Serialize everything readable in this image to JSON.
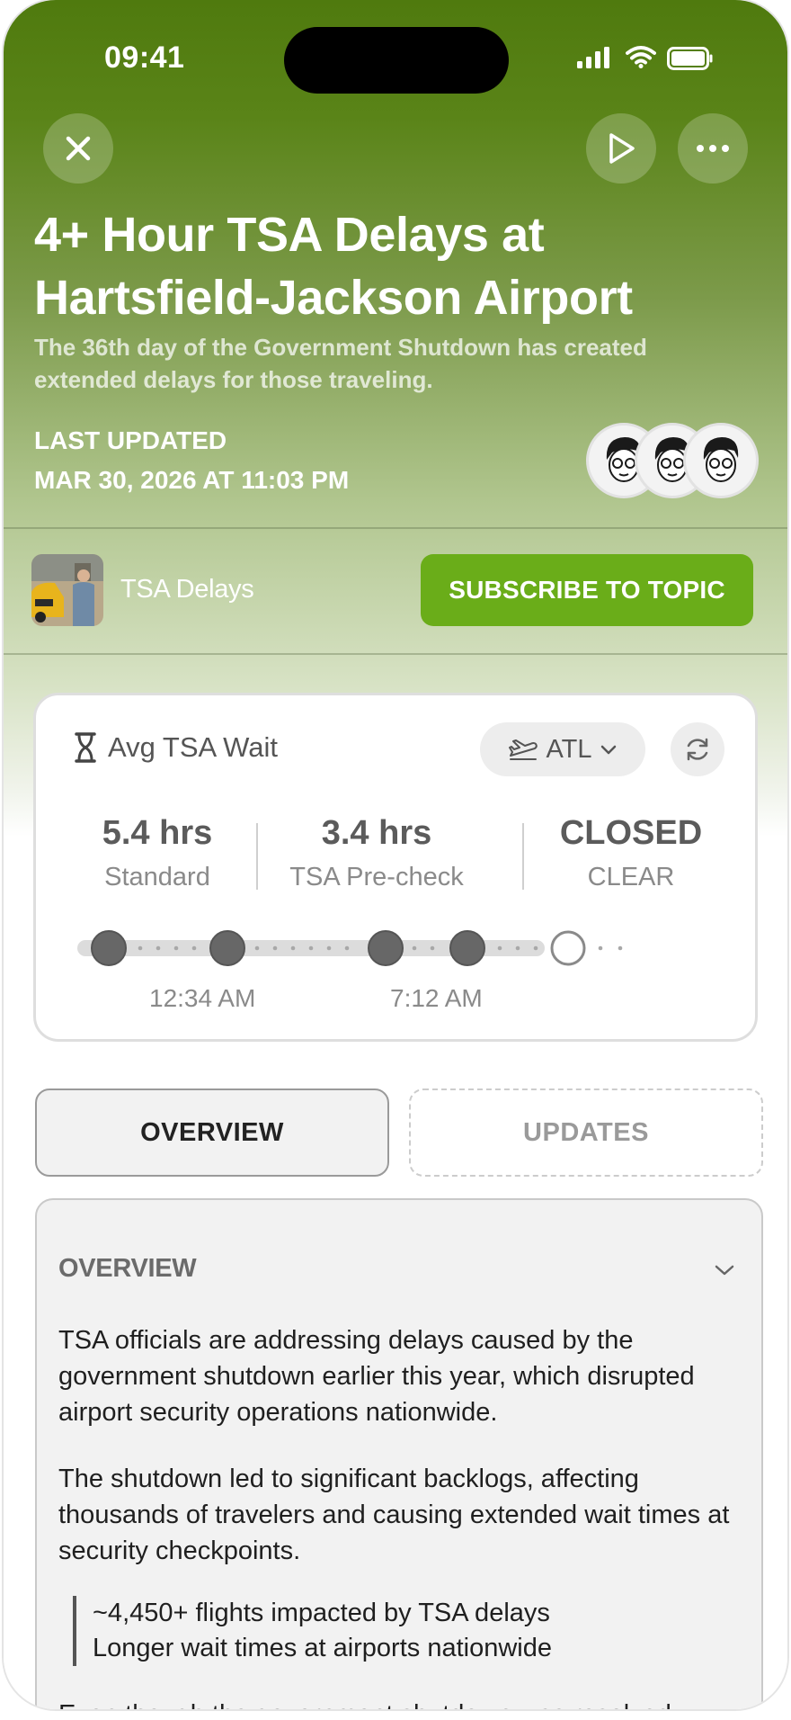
{
  "status_bar": {
    "time": "09:41"
  },
  "header": {
    "title": "4+ Hour TSA Delays at Hartsfield-Jackson Airport",
    "subtitle": "The 36th day of the Government Shutdown has created extended delays for those traveling.",
    "last_updated_label": "LAST UPDATED",
    "last_updated_value": "MAR 30, 2026 AT 11:03 PM",
    "actions": [
      "close-icon",
      "play-icon",
      "more-icon"
    ]
  },
  "topic": {
    "name": "TSA Delays",
    "subscribe_label": "SUBSCRIBE TO TOPIC"
  },
  "wait_card": {
    "title": "Avg TSA Wait",
    "airport": "ATL",
    "stats": [
      {
        "value": "5.4 hrs",
        "label": "Standard"
      },
      {
        "value": "3.4 hrs",
        "label": "TSA Pre-check"
      },
      {
        "value": "CLOSED",
        "label": "CLEAR"
      }
    ],
    "timeline_labels": [
      "12:34 AM",
      "7:12 AM"
    ]
  },
  "tabs": {
    "overview": "OVERVIEW",
    "updates": "UPDATES",
    "active": "overview"
  },
  "overview_panel": {
    "heading": "OVERVIEW",
    "paragraphs": [
      "TSA officials are addressing delays caused by the government shutdown earlier this year, which disrupted airport security operations nationwide.",
      "The shutdown led to significant backlogs, affecting thousands of travelers and causing extended wait times at security checkpoints."
    ],
    "quote_lines": [
      "~4,450+ flights impacted by TSA delays",
      "Longer wait times at airports nationwide"
    ],
    "cut_line": "Even though the government shutdown was resolved,"
  },
  "colors": {
    "header_green": "#4f7a0e",
    "subscribe_green": "#6aad19"
  }
}
